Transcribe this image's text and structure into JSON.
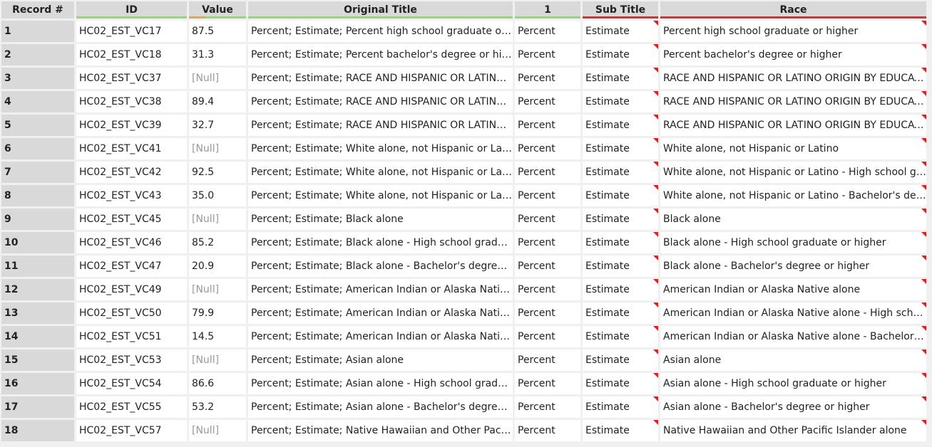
{
  "columns": [
    "Record #",
    "ID",
    "Value",
    "Original Title",
    "1",
    "Sub Title",
    "Race"
  ],
  "colors": {
    "green": "#8fdc6a",
    "orange": "#e8a93a",
    "red": "#e82a2a",
    "null": "#999999"
  },
  "rows": [
    [
      "1",
      "HC02_EST_VC17",
      "87.5",
      "Percent; Estimate; Percent high school graduate or higher",
      "Percent",
      "Estimate",
      "Percent high school graduate or higher"
    ],
    [
      "2",
      "HC02_EST_VC18",
      "31.3",
      "Percent; Estimate; Percent bachelor's degree or higher",
      "Percent",
      "Estimate",
      "Percent bachelor's degree or higher"
    ],
    [
      "3",
      "HC02_EST_VC37",
      "[Null]",
      "Percent; Estimate; RACE AND HISPANIC OR LATINO ORIGIN BY EDUCATIONAL ATTAINMENT",
      "Percent",
      "Estimate",
      "RACE AND HISPANIC OR LATINO ORIGIN BY EDUCATIONAL ATTAINMENT"
    ],
    [
      "4",
      "HC02_EST_VC38",
      "89.4",
      "Percent; Estimate; RACE AND HISPANIC OR LATINO ORIGIN BY EDUCATIONAL ATTAINMENT",
      "Percent",
      "Estimate",
      "RACE AND HISPANIC OR LATINO ORIGIN BY EDUCATIONAL ATTAINMENT"
    ],
    [
      "5",
      "HC02_EST_VC39",
      "32.7",
      "Percent; Estimate; RACE AND HISPANIC OR LATINO ORIGIN BY EDUCATIONAL ATTAINMENT",
      "Percent",
      "Estimate",
      "RACE AND HISPANIC OR LATINO ORIGIN BY EDUCATIONAL ATTAINMENT"
    ],
    [
      "6",
      "HC02_EST_VC41",
      "[Null]",
      "Percent; Estimate; White alone, not Hispanic or Latino",
      "Percent",
      "Estimate",
      "White alone, not Hispanic or Latino"
    ],
    [
      "7",
      "HC02_EST_VC42",
      "92.5",
      "Percent; Estimate; White alone, not Hispanic or Latino - High school graduate or higher",
      "Percent",
      "Estimate",
      "White alone, not Hispanic or Latino - High school graduate or higher"
    ],
    [
      "8",
      "HC02_EST_VC43",
      "35.0",
      "Percent; Estimate; White alone, not Hispanic or Latino - Bachelor's degree or higher",
      "Percent",
      "Estimate",
      "White alone, not Hispanic or Latino - Bachelor's degree or higher"
    ],
    [
      "9",
      "HC02_EST_VC45",
      "[Null]",
      "Percent; Estimate; Black alone",
      "Percent",
      "Estimate",
      "Black alone"
    ],
    [
      "10",
      "HC02_EST_VC46",
      "85.2",
      "Percent; Estimate; Black alone - High school graduate or higher",
      "Percent",
      "Estimate",
      "Black alone - High school graduate or higher"
    ],
    [
      "11",
      "HC02_EST_VC47",
      "20.9",
      "Percent; Estimate; Black alone - Bachelor's degree or higher",
      "Percent",
      "Estimate",
      "Black alone - Bachelor's degree or higher"
    ],
    [
      "12",
      "HC02_EST_VC49",
      "[Null]",
      "Percent; Estimate; American Indian or Alaska Native alone",
      "Percent",
      "Estimate",
      "American Indian or Alaska Native alone"
    ],
    [
      "13",
      "HC02_EST_VC50",
      "79.9",
      "Percent; Estimate; American Indian or Alaska Native alone - High school graduate or higher",
      "Percent",
      "Estimate",
      "American Indian or Alaska Native alone - High school graduate or higher"
    ],
    [
      "14",
      "HC02_EST_VC51",
      "14.5",
      "Percent; Estimate; American Indian or Alaska Native alone - Bachelor's degree or higher",
      "Percent",
      "Estimate",
      "American Indian or Alaska Native alone - Bachelor's degree or higher"
    ],
    [
      "15",
      "HC02_EST_VC53",
      "[Null]",
      "Percent; Estimate; Asian alone",
      "Percent",
      "Estimate",
      "Asian alone"
    ],
    [
      "16",
      "HC02_EST_VC54",
      "86.6",
      "Percent; Estimate; Asian alone - High school graduate or higher",
      "Percent",
      "Estimate",
      "Asian alone - High school graduate or higher"
    ],
    [
      "17",
      "HC02_EST_VC55",
      "53.2",
      "Percent; Estimate; Asian alone - Bachelor's degree or higher",
      "Percent",
      "Estimate",
      "Asian alone - Bachelor's degree or higher"
    ],
    [
      "18",
      "HC02_EST_VC57",
      "[Null]",
      "Percent; Estimate; Native Hawaiian and Other Pacific Islander alone",
      "Percent",
      "Estimate",
      "Native Hawaiian and Other Pacific Islander alone"
    ]
  ]
}
